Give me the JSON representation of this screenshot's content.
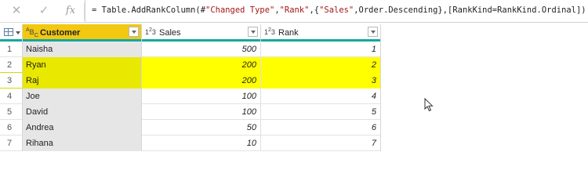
{
  "formula_bar": {
    "cancel_icon": "x-icon",
    "accept_icon": "check-icon",
    "fx_label": "fx",
    "formula_prefix": "= Table.AddRankColumn(#",
    "formula_s1": "\"Changed Type\"",
    "formula_c1": ",",
    "formula_s2": "\"Rank\"",
    "formula_c2": ",{",
    "formula_s3": "\"Sales\"",
    "formula_rest": ",Order.Descending},[RankKind=RankKind.Ordinal])"
  },
  "grid": {
    "columns": [
      {
        "type_icon": "ABC",
        "label": "Customer",
        "selected": true
      },
      {
        "type_icon": "123",
        "label": "Sales",
        "selected": false
      },
      {
        "type_icon": "123",
        "label": "Rank",
        "selected": false
      }
    ],
    "rows": [
      {
        "num": "1",
        "customer": "Naisha",
        "sales": "500",
        "rank": "1",
        "highlight": false
      },
      {
        "num": "2",
        "customer": "Ryan",
        "sales": "200",
        "rank": "2",
        "highlight": true
      },
      {
        "num": "3",
        "customer": "Raj",
        "sales": "200",
        "rank": "3",
        "highlight": true
      },
      {
        "num": "4",
        "customer": "Joe",
        "sales": "100",
        "rank": "4",
        "highlight": false
      },
      {
        "num": "5",
        "customer": "David",
        "sales": "100",
        "rank": "5",
        "highlight": false
      },
      {
        "num": "6",
        "customer": "Andrea",
        "sales": "50",
        "rank": "6",
        "highlight": false
      },
      {
        "num": "7",
        "customer": "Rihana",
        "sales": "10",
        "rank": "7",
        "highlight": false
      }
    ]
  },
  "colors": {
    "selected_header": "#f2c811",
    "highlight_row": "#ffff00",
    "header_accent": "#13a89e"
  }
}
